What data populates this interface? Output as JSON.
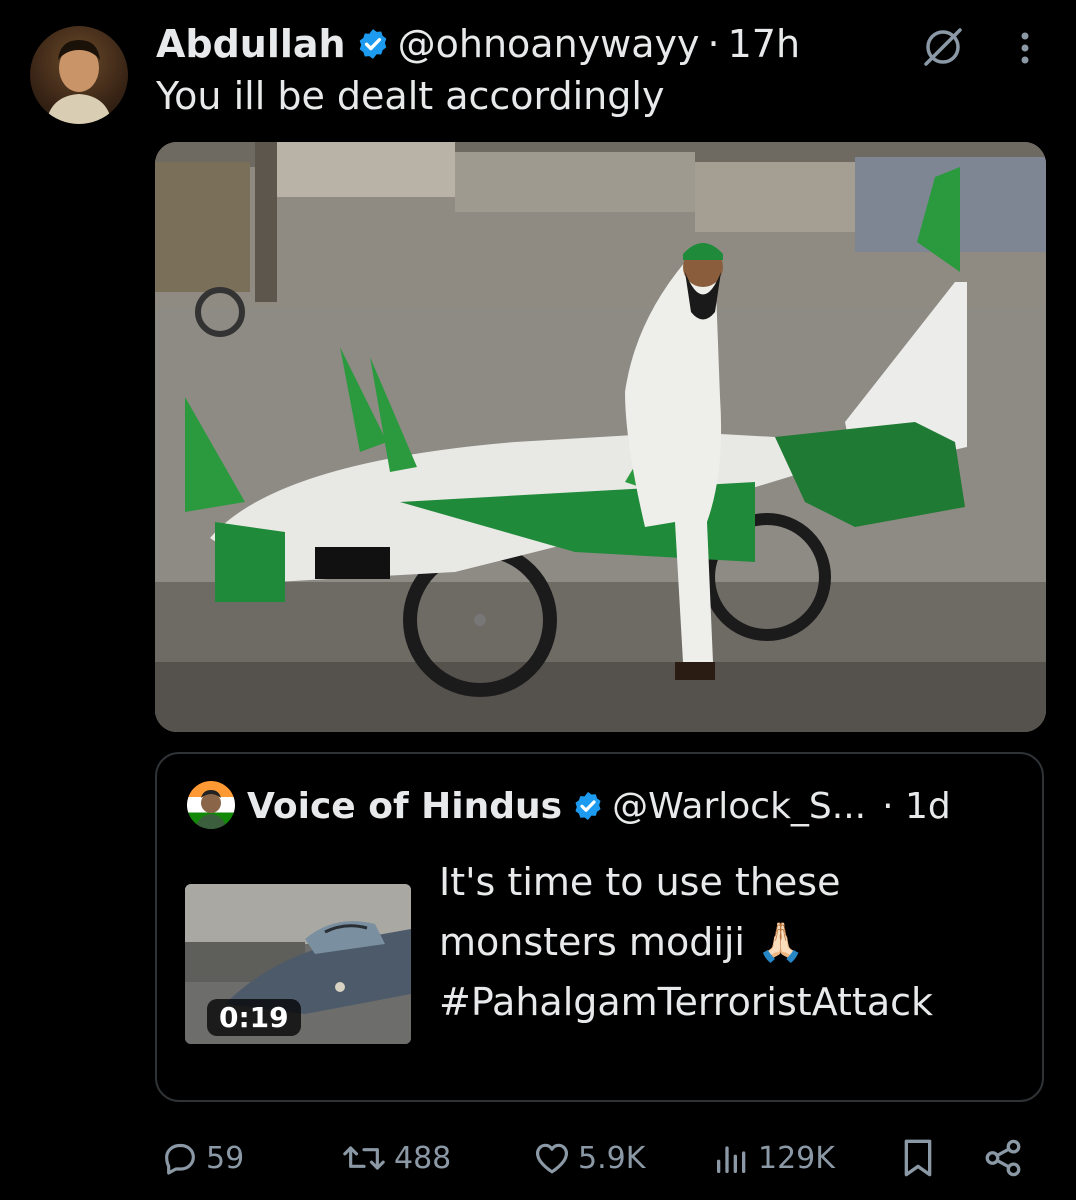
{
  "tweet": {
    "author_name": "Abdullah",
    "handle": "@ohnoanywayy",
    "separator": "·",
    "time": "17h",
    "text": "You ill be dealt accordingly"
  },
  "quote": {
    "author_name": "Voice of Hindus",
    "handle": "@Warlock_S...",
    "time": "· 1d",
    "text_lines": [
      "It's time to use these",
      "monsters modiji 🙏🏻",
      "#PahalgamTerroristAttack"
    ],
    "video_duration": "0:19"
  },
  "actions": {
    "replies": "59",
    "reposts": "488",
    "likes": "5.9K",
    "views": "129K"
  },
  "icons": {
    "verified": "verified-badge-icon",
    "grok": "grok-icon",
    "more": "more-options-icon",
    "reply": "reply-icon",
    "repost": "repost-icon",
    "like": "like-icon",
    "views": "views-icon",
    "bookmark": "bookmark-icon",
    "share": "share-icon"
  },
  "colors": {
    "background": "#000000",
    "text": "#e7e9ea",
    "secondary": "#8b98a5",
    "verified": "#1d9bf0",
    "border": "#2f3336"
  }
}
